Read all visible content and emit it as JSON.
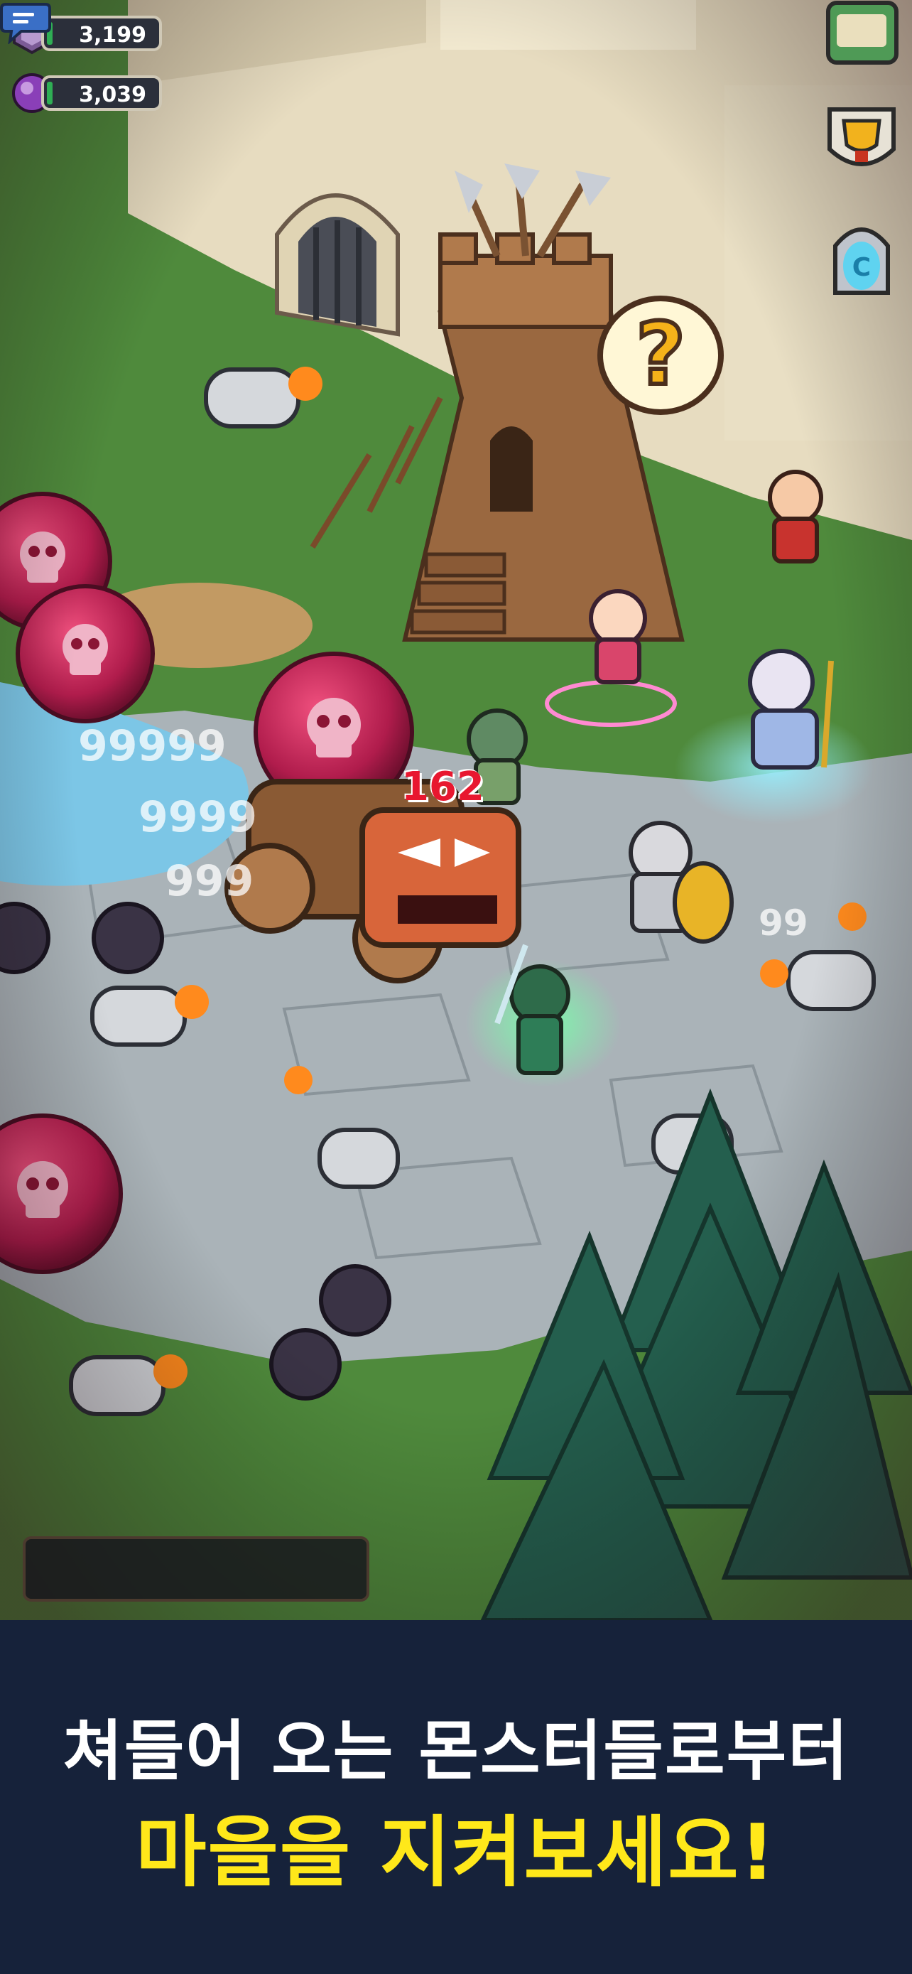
{
  "resources": {
    "gem": {
      "value": "3,199",
      "color": "#7b5b96",
      "bar_color": "#2fae54"
    },
    "orb": {
      "value": "3,039",
      "color": "#8a3fb8",
      "bar_color": "#2fae54"
    }
  },
  "side_buttons": [
    {
      "name": "quest-scroll",
      "icon": "scroll-icon"
    },
    {
      "name": "trophy",
      "icon": "trophy-icon"
    },
    {
      "name": "portal",
      "icon": "portal-icon"
    }
  ],
  "battle": {
    "damage_red": "162",
    "damage_floats": [
      "99999",
      "9999",
      "999",
      "99"
    ],
    "help_icon": "question-bubble-icon"
  },
  "chat": {
    "icon": "chat-bubble-icon"
  },
  "caption": {
    "line1": "쳐들어 오는 몬스터들로부터",
    "line2": "마을을 지켜보세요!"
  },
  "colors": {
    "caption_bg": "#16223a",
    "caption_highlight": "#ffe81a",
    "grass": "#4f8a3c",
    "stone_path": "#aab3b8",
    "danger": "#c8245a"
  }
}
